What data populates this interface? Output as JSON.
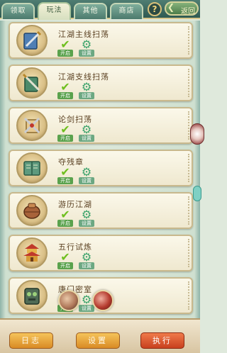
{
  "tabs": [
    {
      "label": "领取",
      "active": false
    },
    {
      "label": "玩法",
      "active": true
    },
    {
      "label": "其他",
      "active": false
    },
    {
      "label": "商店",
      "active": false
    }
  ],
  "header": {
    "help_label": "?",
    "back_label": "返回"
  },
  "rows": [
    {
      "title": "江湖主线扫荡",
      "icon": "sword-scroll-icon",
      "open_label": "开启",
      "settings_label": "设置"
    },
    {
      "title": "江湖支线扫荡",
      "icon": "sword-scroll-icon",
      "open_label": "开启",
      "settings_label": "设置"
    },
    {
      "title": "论剑扫荡",
      "icon": "crossed-swords-icon",
      "open_label": "开启",
      "settings_label": "设置"
    },
    {
      "title": "夺残章",
      "icon": "book-icon",
      "open_label": "开启",
      "settings_label": "设置"
    },
    {
      "title": "游历江湖",
      "icon": "bag-icon",
      "open_label": "开启",
      "settings_label": "设置"
    },
    {
      "title": "五行试炼",
      "icon": "pagoda-icon",
      "open_label": "开启",
      "settings_label": "设置"
    },
    {
      "title": "唐门密室",
      "icon": "chest-icon",
      "open_label": "开启",
      "settings_label": "设置"
    }
  ],
  "footer": {
    "log_label": "日志",
    "settings_label": "设置",
    "execute_label": "执行"
  },
  "colors": {
    "accent_green": "#6fbf1f",
    "button_orange": "#d98b25",
    "execute_red": "#c8401f"
  }
}
